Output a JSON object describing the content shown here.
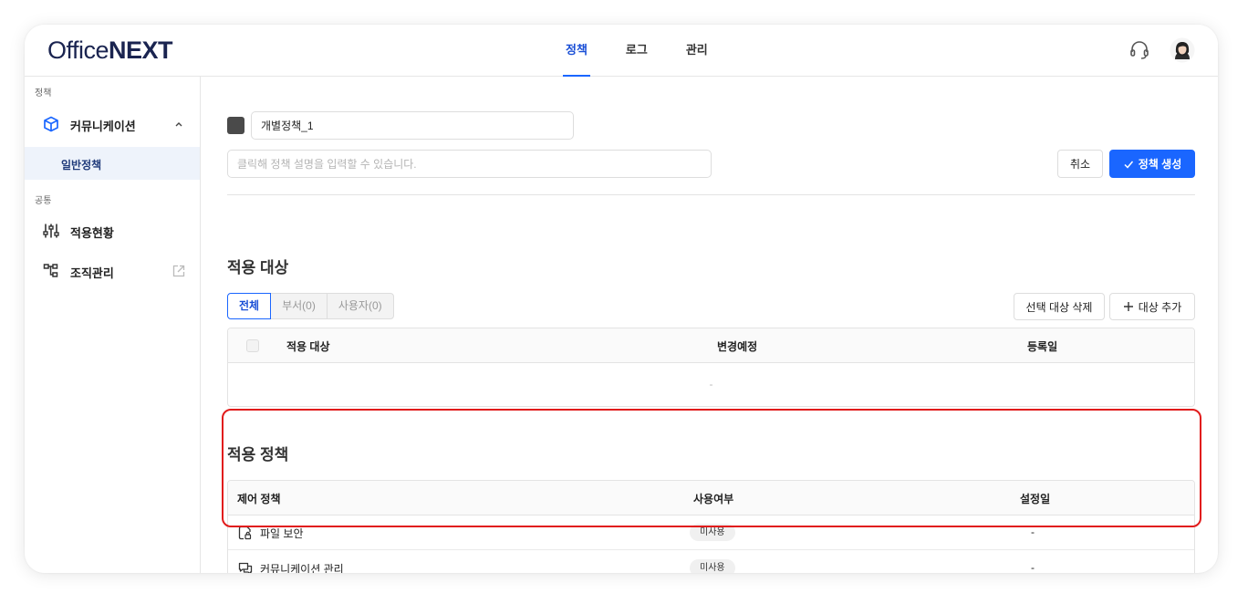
{
  "app": {
    "logo_part1": "Office",
    "logo_part2": "NEXT"
  },
  "nav": {
    "tabs": [
      {
        "label": "정책",
        "active": true
      },
      {
        "label": "로그",
        "active": false
      },
      {
        "label": "관리",
        "active": false
      }
    ]
  },
  "sidebar": {
    "section1_label": "정책",
    "communication_label": "커뮤니케이션",
    "general_policy_label": "일반정책",
    "section2_label": "공통",
    "apply_status_label": "적용현황",
    "org_mgmt_label": "조직관리"
  },
  "policy": {
    "name_value": "개별정책_1",
    "description_placeholder": "클릭해 정책 설명을 입력할 수 있습니다.",
    "cancel_label": "취소",
    "create_label": "정책 생성",
    "swatch_color": "#4a4a4a"
  },
  "targets": {
    "title": "적용 대상",
    "tabs": [
      "전체",
      "부서(0)",
      "사용자(0)"
    ],
    "delete_label": "선택 대상 삭제",
    "add_label": "대상 추가",
    "columns": [
      "적용 대상",
      "변경예정",
      "등록일"
    ],
    "empty_text": "-"
  },
  "policies": {
    "title": "적용 정책",
    "columns": [
      "제어 정책",
      "사용여부",
      "설정일"
    ],
    "rows": [
      {
        "name": "파일 보안",
        "status": "미사용",
        "date": "-"
      },
      {
        "name": "커뮤니케이션 관리",
        "status": "미사용",
        "date": "-"
      }
    ]
  },
  "colors": {
    "accent": "#1a66ff",
    "highlight": "#e11b1b",
    "logo": "#1a2450"
  }
}
